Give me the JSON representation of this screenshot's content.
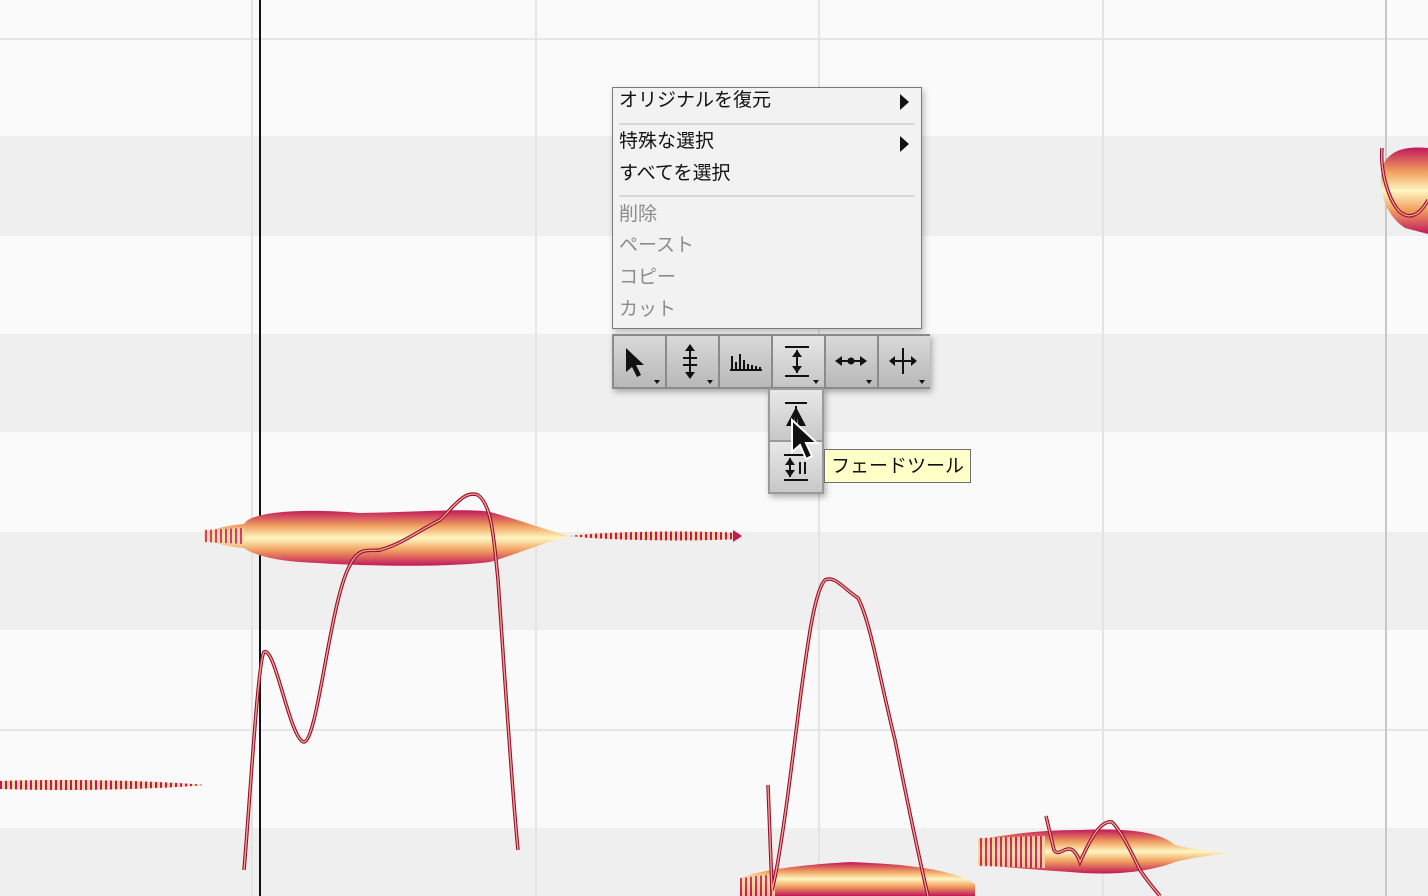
{
  "context_menu": {
    "items": [
      {
        "label": "オリジナルを復元",
        "enabled": true,
        "submenu": true
      },
      {
        "label": "特殊な選択",
        "enabled": true,
        "submenu": true
      },
      {
        "label": "すべてを選択",
        "enabled": true,
        "submenu": false
      },
      {
        "label": "削除",
        "enabled": false,
        "submenu": false
      },
      {
        "label": "ペースト",
        "enabled": false,
        "submenu": false
      },
      {
        "label": "コピー",
        "enabled": false,
        "submenu": false
      },
      {
        "label": "カット",
        "enabled": false,
        "submenu": false
      }
    ]
  },
  "toolbar": {
    "tools": [
      {
        "icon": "arrow-pointer-icon",
        "name": "main-tool"
      },
      {
        "icon": "pitch-tool-icon",
        "name": "pitch-tool"
      },
      {
        "icon": "formant-tool-icon",
        "name": "formant-tool"
      },
      {
        "icon": "amplitude-tool-icon",
        "name": "amplitude-tool",
        "active": true
      },
      {
        "icon": "time-tool-icon",
        "name": "time-tool"
      },
      {
        "icon": "separation-tool-icon",
        "name": "separation-tool"
      }
    ]
  },
  "amplitude_subtools": [
    {
      "icon": "amplitude-tool-icon"
    },
    {
      "icon": "fade-tool-icon"
    }
  ],
  "tooltip": {
    "text": "フェードツール"
  },
  "colors": {
    "blob_outer": "#c0164e",
    "blob_inner": "#fff3b0",
    "pitch_curve": "#c0163a",
    "lane_dark": "#efefef",
    "lane_light": "#fafafa"
  }
}
